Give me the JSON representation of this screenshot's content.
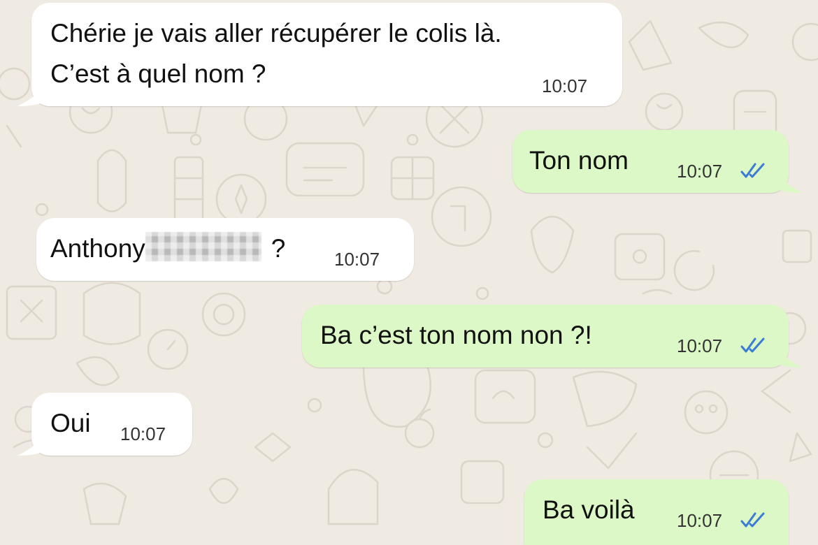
{
  "chat": {
    "messages": [
      {
        "direction": "incoming",
        "lines": [
          "Chérie je vais aller récupérer le colis là.",
          "C’est à quel nom ?"
        ],
        "time": "10:07"
      },
      {
        "direction": "outgoing",
        "text": "Ton nom",
        "time": "10:07",
        "status": "read"
      },
      {
        "direction": "incoming",
        "text_before": "Anthony",
        "redacted": true,
        "text_after": "?",
        "time": "10:07"
      },
      {
        "direction": "outgoing",
        "text": "Ba c’est ton nom non ?!",
        "time": "10:07",
        "status": "read"
      },
      {
        "direction": "incoming",
        "text": "Oui",
        "time": "10:07"
      },
      {
        "direction": "outgoing",
        "text": "Ba voilà",
        "time": "10:07",
        "status": "read"
      }
    ]
  },
  "colors": {
    "background": "#efeae2",
    "incoming_bubble": "#ffffff",
    "outgoing_bubble": "#dcf8c6",
    "read_ticks": "#3a7bd5"
  },
  "icons": {
    "read_status": "double-check-icon",
    "redaction": "pixelated-redaction"
  }
}
